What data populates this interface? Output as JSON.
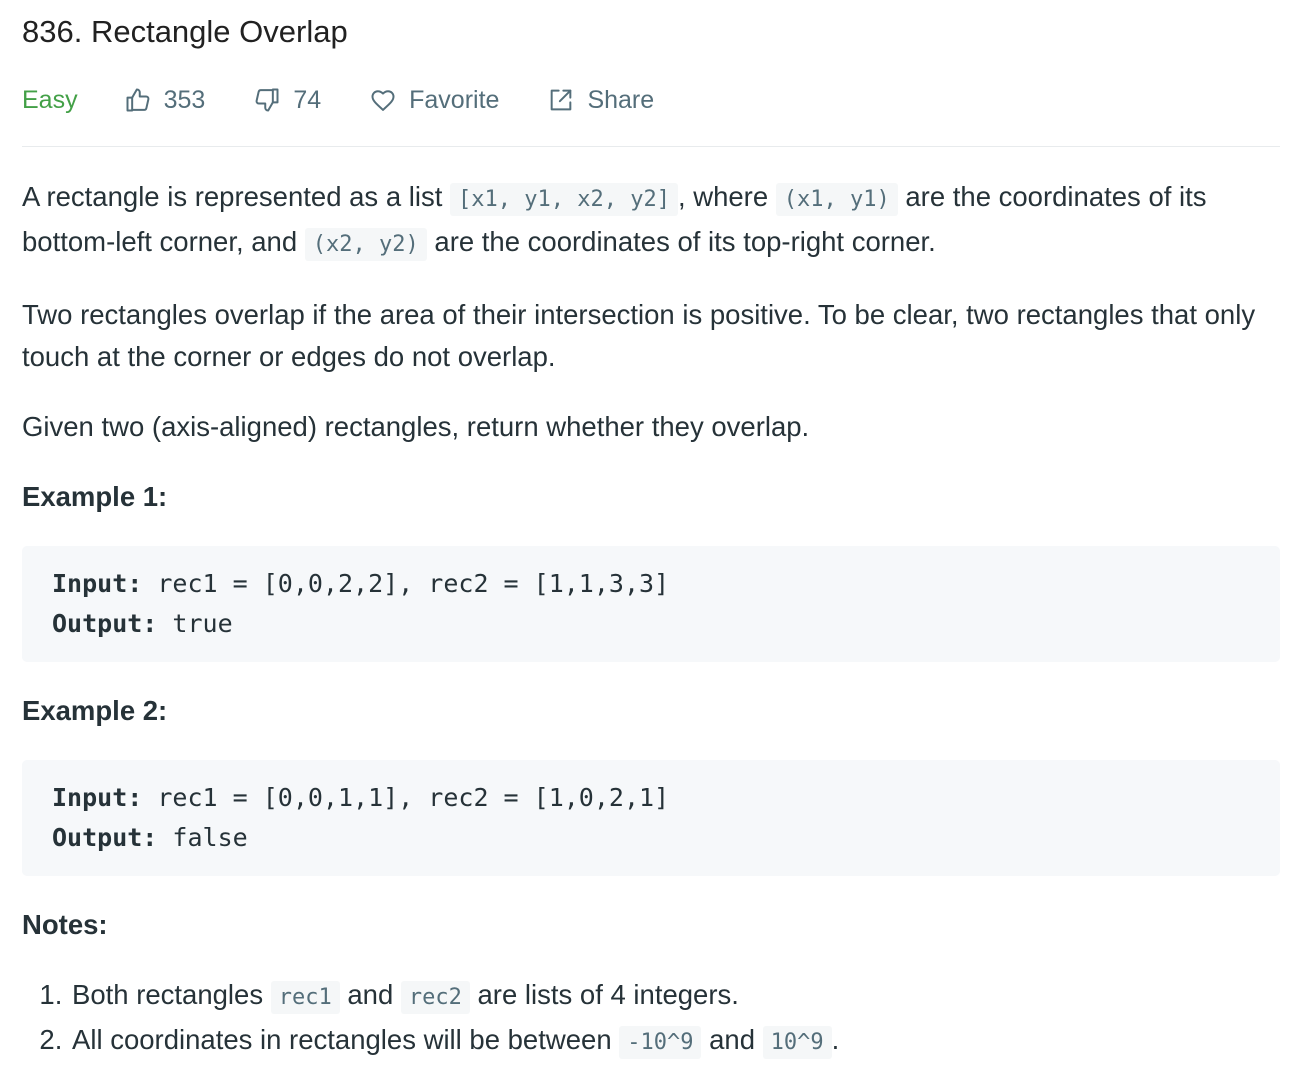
{
  "problem": {
    "title": "836. Rectangle Overlap",
    "difficulty": "Easy",
    "likes": "353",
    "dislikes": "74",
    "favorite_label": "Favorite",
    "share_label": "Share"
  },
  "description": {
    "p1_a": "A rectangle is represented as a list ",
    "p1_code1": "[x1, y1, x2, y2]",
    "p1_b": ", where ",
    "p1_code2": "(x1, y1)",
    "p1_c": " are the coordinates of its bottom-left corner, and ",
    "p1_code3": "(x2, y2)",
    "p1_d": " are the coordinates of its top-right corner.",
    "p2": "Two rectangles overlap if the area of their intersection is positive.  To be clear, two rectangles that only touch at the corner or edges do not overlap.",
    "p3": "Given two (axis-aligned) rectangles, return whether they overlap."
  },
  "examples": [
    {
      "heading": "Example 1:",
      "input_label": "Input:",
      "input_value": " rec1 = [0,0,2,2], rec2 = [1,1,3,3]",
      "output_label": "Output:",
      "output_value": " true"
    },
    {
      "heading": "Example 2:",
      "input_label": "Input:",
      "input_value": " rec1 = [0,0,1,1], rec2 = [1,0,2,1]",
      "output_label": "Output:",
      "output_value": " false"
    }
  ],
  "notes": {
    "heading": "Notes:",
    "n1_a": "Both rectangles ",
    "n1_code1": "rec1",
    "n1_b": " and ",
    "n1_code2": "rec2",
    "n1_c": " are lists of 4 integers.",
    "n2_a": "All coordinates in rectangles will be between ",
    "n2_code1": "-10^9",
    "n2_b": " and ",
    "n2_code2": "10^9",
    "n2_c": "."
  },
  "icons": {
    "like": "thumbs-up-icon",
    "dislike": "thumbs-down-icon",
    "favorite": "heart-icon",
    "share": "share-icon"
  },
  "colors": {
    "difficulty_easy": "#43a047",
    "meta_gray": "#546e7a",
    "code_bg": "#f6f8fa"
  }
}
